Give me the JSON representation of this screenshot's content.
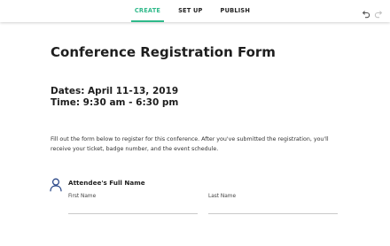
{
  "toolbar": {
    "tabs": [
      {
        "label": "CREATE",
        "active": true
      },
      {
        "label": "SET UP",
        "active": false
      },
      {
        "label": "PUBLISH",
        "active": false
      }
    ],
    "undo_icon": "undo-icon",
    "redo_icon": "redo-icon",
    "accent_color": "#2fb98a"
  },
  "form": {
    "title": "Conference Registration Form",
    "dates_line": "Dates: April 11-13, 2019",
    "time_line": "Time: 9:30 am - 6:30 pm",
    "intro": "Fill out the form below to register for this conference. After you've submitted the registration, you'll receive your ticket, badge number, and the event schedule.",
    "attendee": {
      "icon": "person-icon",
      "label": "Attendee's Full Name",
      "first_name_label": "First Name",
      "last_name_label": "Last Name",
      "first_name_value": "",
      "last_name_value": ""
    }
  }
}
